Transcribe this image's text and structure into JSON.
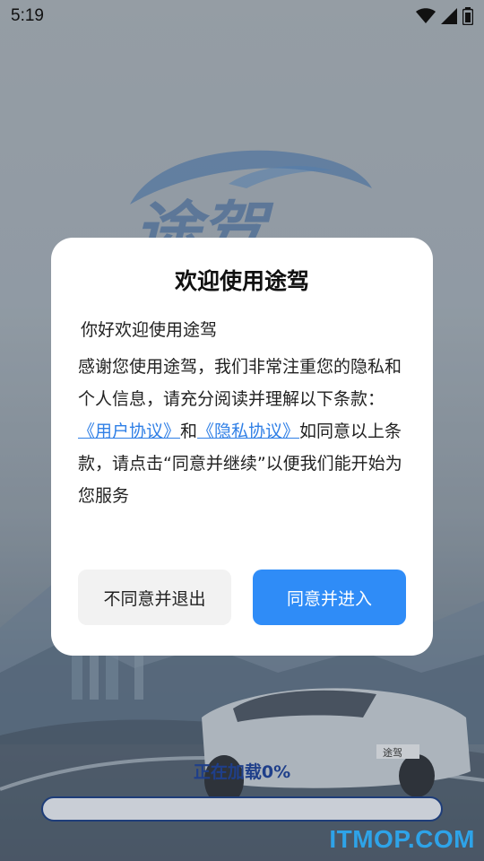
{
  "status_bar": {
    "time": "5:19",
    "icons": [
      "wifi-icon",
      "signal-icon",
      "battery-icon"
    ]
  },
  "background": {
    "logo_text": "途驾",
    "car_plate": "途驾"
  },
  "dialog": {
    "title": "欢迎使用途驾",
    "greeting": "你好欢迎使用途驾",
    "intro": "感谢您使用途驾，我们非常注重您的隐私和个人信息，请充分阅读并理解以下条款：",
    "user_agreement_link": "《用户协议》",
    "and_text": "和",
    "privacy_link": "《隐私协议》",
    "closing": "如同意以上条款，请点击“同意并继续”以便我们能开始为您服务",
    "disagree_button": "不同意并退出",
    "agree_button": "同意并进入"
  },
  "loading": {
    "text": "正在加载0%",
    "progress": 0
  },
  "watermark": "ITMOP.COM",
  "colors": {
    "link": "#2f7fe6",
    "primary_button": "#2f8cf7",
    "progress_border": "#1e3d79"
  }
}
